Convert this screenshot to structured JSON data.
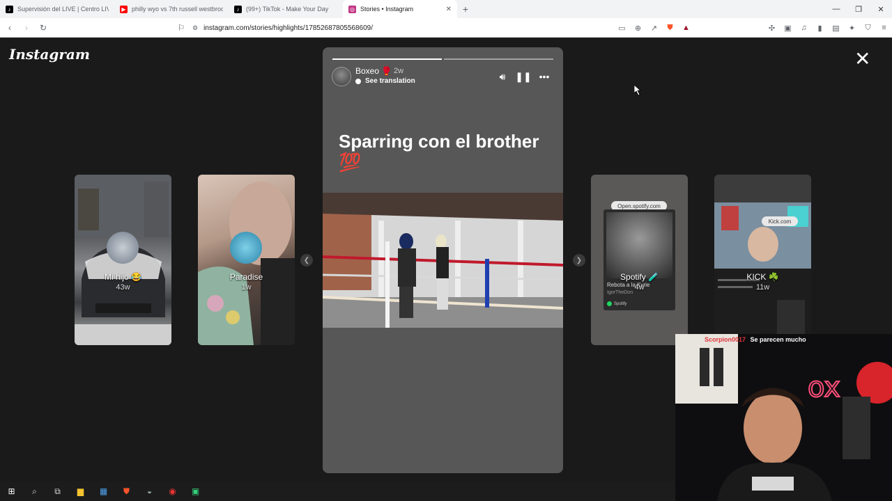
{
  "browser": {
    "tabs": [
      {
        "label": "Supervisión del LIVE | Centro LIVE de",
        "icon": "tiktok-icon",
        "color": "#000000",
        "active": false
      },
      {
        "label": "philly wyo vs 7th russell westbrook -",
        "icon": "youtube-icon",
        "color": "#ff0000",
        "active": false
      },
      {
        "label": "(99+) TikTok - Make Your Day",
        "icon": "tiktok-icon",
        "color": "#000000",
        "active": false
      },
      {
        "label": "Stories • Instagram",
        "icon": "instagram-icon",
        "color": "#c13584",
        "active": true
      }
    ],
    "new_tab_label": "+",
    "url": "instagram.com/stories/highlights/17852687805568609/"
  },
  "instagram": {
    "logo": "Instagram",
    "close_label": "✕",
    "story": {
      "username": "Boxeo 🥊",
      "time": "2w",
      "translation": "See translation",
      "caption": "Sparring con el brother 💯"
    },
    "highlights_left": [
      {
        "title": "Mi hijo 😂",
        "time": "43w"
      },
      {
        "title": "Paradise",
        "time": "1w"
      }
    ],
    "highlights_right": [
      {
        "title": "Spotify 🧪",
        "time": "4w",
        "badge": "Open.spotify.com",
        "song": "Rebota a la Kyrie",
        "artist": "IgorTheDon",
        "footer": "Spotify"
      },
      {
        "title": "KICK ☘️",
        "time": "11w",
        "badge": "Kick.com"
      }
    ]
  },
  "stream": {
    "chat_user": "Scorpion0017",
    "chat_message": "Se parecen mucho"
  }
}
